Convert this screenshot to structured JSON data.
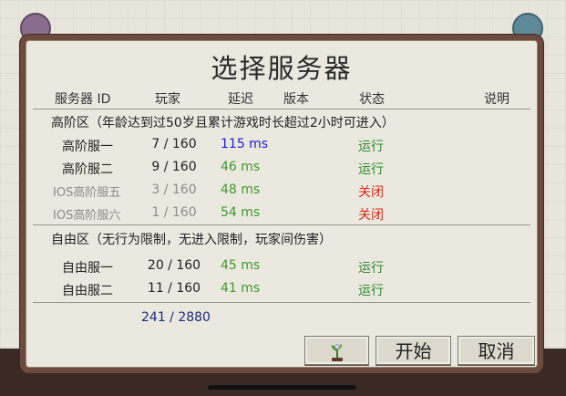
{
  "dialog": {
    "title": "选择服务器"
  },
  "columns": {
    "server_id": "服务器 ID",
    "players": "玩家",
    "latency": "延迟",
    "version": "版本",
    "status": "状态",
    "description": "说明"
  },
  "sections": [
    {
      "label": "高阶区（年龄达到过50岁且累计游戏时长超过2小时可进入）",
      "servers": [
        {
          "name": "高阶服一",
          "players": "7 / 160",
          "ping": "115 ms",
          "status": "运行"
        },
        {
          "name": "高阶服二",
          "players": "9 / 160",
          "ping": "46 ms",
          "status": "运行"
        },
        {
          "name": "IOS高阶服五",
          "players": "3 / 160",
          "ping": "48 ms",
          "status": "关闭"
        },
        {
          "name": "IOS高阶服六",
          "players": "1 / 160",
          "ping": "54 ms",
          "status": "关闭"
        }
      ]
    },
    {
      "label": "自由区（无行为限制，无进入限制，玩家间伤害）",
      "servers": [
        {
          "name": "自由服一",
          "players": "20 / 160",
          "ping": "45 ms",
          "status": "运行"
        },
        {
          "name": "自由服二",
          "players": "11 / 160",
          "ping": "41 ms",
          "status": "运行"
        }
      ]
    }
  ],
  "total_players": "241 / 2880",
  "buttons": {
    "start": "开始",
    "cancel": "取消",
    "mods_icon": "sprout-icon"
  },
  "colors": {
    "frame": "#6b4b3e",
    "panel": "#ebe8df",
    "ping_high": "#1d1dd1",
    "ping_ok": "#3e9a2e",
    "status_running": "#2e8b2e",
    "status_closed": "#d42a1a"
  }
}
